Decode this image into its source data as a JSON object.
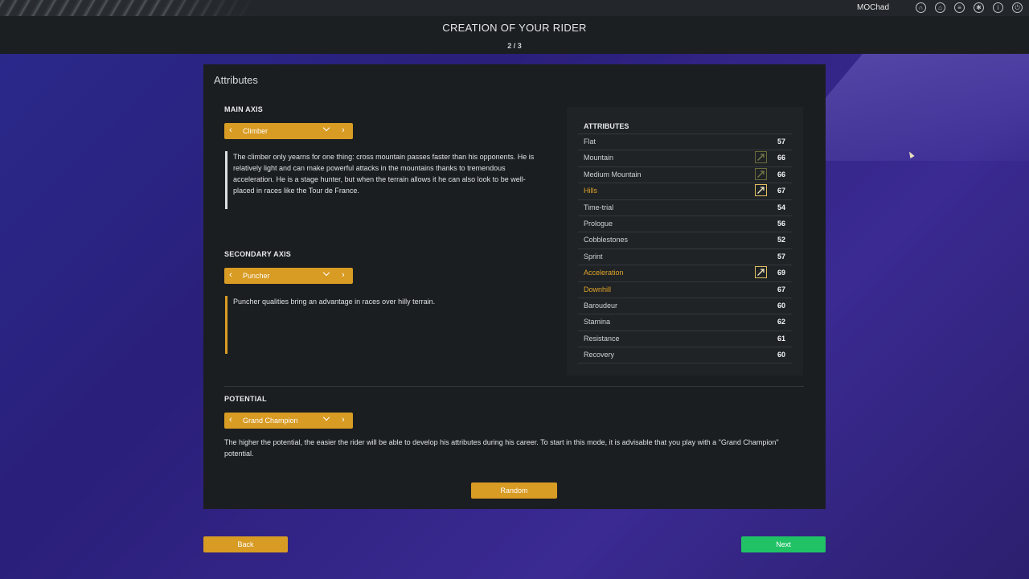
{
  "topbar": {
    "username": "MOChad",
    "icons": [
      "headset-icon",
      "shop-icon",
      "list-icon",
      "settings-icon",
      "info-icon",
      "power-icon"
    ]
  },
  "header": {
    "title": "CREATION OF YOUR RIDER",
    "step": "2 / 3"
  },
  "panel": {
    "title": "Attributes",
    "main_axis": {
      "label": "MAIN AXIS",
      "selected": "Climber",
      "description": "The climber only yearns for one thing: cross mountain passes faster than his opponents. He is relatively light and can make powerful attacks in the mountains thanks to tremendous acceleration. He is a stage hunter, but when the terrain allows it he can also look to be well-placed in races like the Tour de France."
    },
    "secondary_axis": {
      "label": "SECONDARY AXIS",
      "selected": "Puncher",
      "description": "Puncher qualities bring an advantage in races over hilly terrain."
    },
    "potential": {
      "label": "POTENTIAL",
      "selected": "Grand Champion",
      "description": "The higher the potential, the easier the rider will be able to develop his attributes during his career. To start in this mode, it is advisable that you play with a \"Grand Champion\" potential."
    },
    "random_label": "Random"
  },
  "attributes": {
    "heading": "ATTRIBUTES",
    "items": [
      {
        "name": "Flat",
        "value": "57",
        "highlight": false,
        "icon": null
      },
      {
        "name": "Mountain",
        "value": "66",
        "highlight": false,
        "icon": "dim-arrow-icon"
      },
      {
        "name": "Medium Mountain",
        "value": "66",
        "highlight": false,
        "icon": "dim-arrow-icon"
      },
      {
        "name": "Hills",
        "value": "67",
        "highlight": true,
        "icon": "arrow-icon"
      },
      {
        "name": "Time-trial",
        "value": "54",
        "highlight": false,
        "icon": null
      },
      {
        "name": "Prologue",
        "value": "56",
        "highlight": false,
        "icon": null
      },
      {
        "name": "Cobblestones",
        "value": "52",
        "highlight": false,
        "icon": null
      },
      {
        "name": "Sprint",
        "value": "57",
        "highlight": false,
        "icon": null
      },
      {
        "name": "Acceleration",
        "value": "69",
        "highlight": true,
        "icon": "arrow-icon"
      },
      {
        "name": "Downhill",
        "value": "67",
        "highlight": true,
        "icon": null
      },
      {
        "name": "Baroudeur",
        "value": "60",
        "highlight": false,
        "icon": null
      },
      {
        "name": "Stamina",
        "value": "62",
        "highlight": false,
        "icon": null
      },
      {
        "name": "Resistance",
        "value": "61",
        "highlight": false,
        "icon": null
      },
      {
        "name": "Recovery",
        "value": "60",
        "highlight": false,
        "icon": null
      }
    ]
  },
  "footer": {
    "back_label": "Back",
    "next_label": "Next"
  },
  "colors": {
    "accent": "#d89b23",
    "next": "#21c266",
    "highlight_text": "#e2a428"
  }
}
